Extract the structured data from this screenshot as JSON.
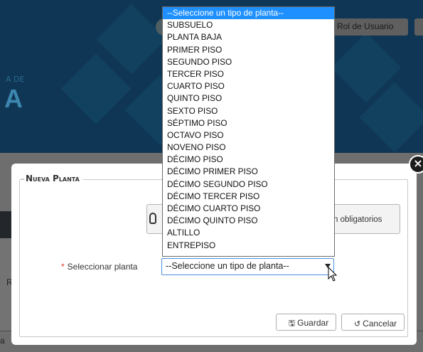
{
  "background": {
    "header_small_text": "A DE",
    "header_big_text": "A",
    "role_button_label": "Rol de Usuario",
    "partial_letter_r": "R",
    "partial_letter_a": "a"
  },
  "modal": {
    "legend": "Nueva Planta",
    "close_icon": "close-icon",
    "notice_text": "n obligatorios",
    "field": {
      "required_mark": "*",
      "label": "Seleccionar planta",
      "selected_value": "--Seleccione un tipo de planta--"
    },
    "buttons": {
      "save_label": "Guardar",
      "cancel_label": "Cancelar"
    }
  },
  "dropdown": {
    "options": [
      "--Seleccione un tipo de planta--",
      "SUBSUELO",
      "PLANTA BAJA",
      "PRIMER PISO",
      "SEGUNDO PISO",
      "TERCER PISO",
      "CUARTO PISO",
      "QUINTO PISO",
      "SEXTO PISO",
      "SÉPTIMO PISO",
      "OCTAVO PISO",
      "NOVENO PISO",
      "DÉCIMO PISO",
      "DÉCIMO PRIMER PISO",
      "DÉCIMO SEGUNDO PISO",
      "DÉCIMO TERCER PISO",
      "DÉCIMO CUARTO PISO",
      "DÉCIMO QUINTO PISO",
      "ALTILLO",
      "ENTREPISO"
    ]
  },
  "colors": {
    "highlight": "#1e90ff",
    "required": "#e0342f",
    "overlay_header": "#0f3654"
  }
}
